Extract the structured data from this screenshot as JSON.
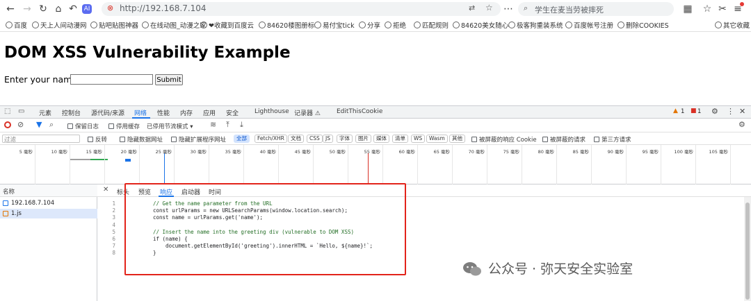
{
  "browser": {
    "url": "http://192.168.7.104",
    "search_placeholder": "学生在麦当劳被摔死"
  },
  "bookmarks": [
    "百度",
    "天上人间动漫网",
    "贴吧贴图神器",
    "在线动图_动漫之家",
    "❤收藏到百度云",
    "84620楼图册标",
    "易付宝tick",
    "分享",
    "拒绝",
    "匹配规则",
    "84620美女随心",
    "极客狗重装系统",
    "百度帐号注册",
    "删除COOKIES",
    "其它收藏"
  ],
  "page": {
    "title": "DOM XSS Vulnerability Example",
    "label": "Enter your name:",
    "submit": "Submit"
  },
  "devtools": {
    "tabs": [
      "元素",
      "控制台",
      "源代码/来源",
      "网络",
      "性能",
      "内存",
      "应用",
      "安全",
      "Lighthouse",
      "记录器 ⚠",
      "EditThisCookie"
    ],
    "active_tab": "网络",
    "badges": {
      "warnings": "1",
      "errors": "1"
    },
    "toolbar": {
      "preserve_log": "保留日志",
      "disable_cache": "停用缓存",
      "throttle": "已停用节流模式"
    },
    "filter": {
      "placeholder": "过滤",
      "invert": "反转",
      "hide_data_urls": "隐藏数据网址",
      "hide_ext_urls": "隐藏扩展程序网址",
      "types": [
        "全部",
        "Fetch/XHR",
        "文档",
        "CSS",
        "JS",
        "字体",
        "图片",
        "媒体",
        "清单",
        "WS",
        "Wasm",
        "其他"
      ],
      "blocked_cookies": "被屏蔽的响应 Cookie",
      "blocked_requests": "被屏蔽的请求",
      "third_party": "第三方请求"
    },
    "timeline_ticks": [
      "5 毫秒",
      "10 毫秒",
      "15 毫秒",
      "20 毫秒",
      "25 毫秒",
      "30 毫秒",
      "35 毫秒",
      "40 毫秒",
      "45 毫秒",
      "50 毫秒",
      "55 毫秒",
      "60 毫秒",
      "65 毫秒",
      "70 毫秒",
      "75 毫秒",
      "80 毫秒",
      "85 毫秒",
      "90 毫秒",
      "95 毫秒",
      "100 毫秒",
      "105 毫秒",
      "110"
    ],
    "name_header": "名称",
    "requests": [
      "192.168.7.104",
      "1.js"
    ],
    "detail_tabs": [
      "标头",
      "预览",
      "响应",
      "启动器",
      "时间"
    ],
    "active_detail_tab": "响应",
    "code_lines": [
      {
        "n": "1",
        "text": "// Get the name parameter from the URL"
      },
      {
        "n": "2",
        "text": "const urlParams = new URLSearchParams(window.location.search);"
      },
      {
        "n": "3",
        "text": "const name = urlParams.get('name');"
      },
      {
        "n": "4",
        "text": ""
      },
      {
        "n": "5",
        "text": "// Insert the name into the greeting div (vulnerable to DOM XSS)"
      },
      {
        "n": "6",
        "text": "if (name) {"
      },
      {
        "n": "7",
        "text": "    document.getElementById('greeting').innerHTML = `Hello, ${name}!`;"
      },
      {
        "n": "8",
        "text": "}"
      }
    ]
  },
  "watermark": "公众号 · 弥天安全实验室"
}
